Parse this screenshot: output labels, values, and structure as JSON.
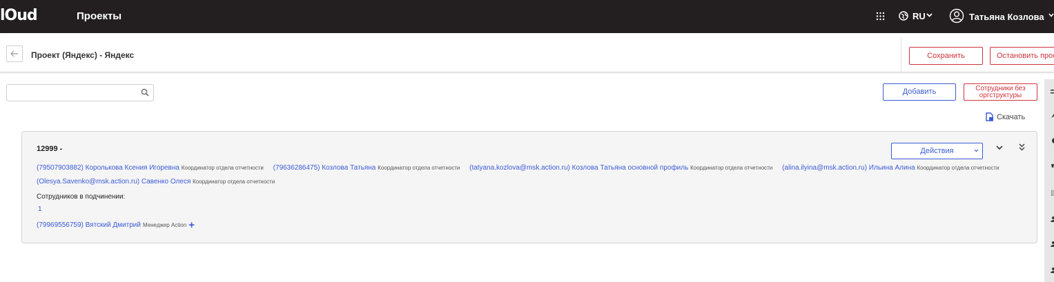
{
  "topbar": {
    "logo": "lOud",
    "nav_title": "Проекты",
    "apps_icon": "apps-grid-icon",
    "globe_icon": "globe-icon",
    "language": "RU",
    "user_icon": "user-circle-icon",
    "user_name": "Татьяна Козлова",
    "bg_color": "#231f20"
  },
  "header": {
    "back_icon": "arrow-left-icon",
    "project_title": "Проект (Яндекс) - Яндекс",
    "save_label": "Сохранить",
    "stop_label": "Остановить проек"
  },
  "toolbar": {
    "search_placeholder": "",
    "search_value": "",
    "add_label": "Добавить",
    "no_org_label_line1": "Сотрудники без",
    "no_org_label_line2": "оргструктуры",
    "download_label": "Скачать",
    "download_icon": "file-download-icon"
  },
  "colors": {
    "accent_blue": "#3b5bd6",
    "accent_red": "#d0333b"
  },
  "card": {
    "title": "12999 -",
    "actions_label": "Действия",
    "members": [
      {
        "link": "(79507903882) Королькова Ксения Игоревна",
        "role": "Координатор отдела отчетности"
      },
      {
        "link": "(79636286475) Козлова Татьяна",
        "role": "Координатор отдела отчетности"
      },
      {
        "link": "(tatyana.kozlova@msk.action.ru) Козлова Татьяна основной профиль",
        "role": "Координатор отдела отчетности"
      },
      {
        "link": "(alina.ilyina@msk.action.ru) Ильина Алина",
        "role": "Координатор отдела отчетности"
      },
      {
        "link": "(Olesya.Savenko@msk.action.ru) Савенко Олеся",
        "role": "Координатор отдела отчетности"
      }
    ],
    "subordinates_label": "Сотрудников в подчинении:",
    "subordinates_count": "1",
    "subordinate": {
      "link": "(79969556759) Вятский Дмитрий",
      "role": "Менеджер Action"
    },
    "add_subordinate_icon": "plus-icon"
  }
}
